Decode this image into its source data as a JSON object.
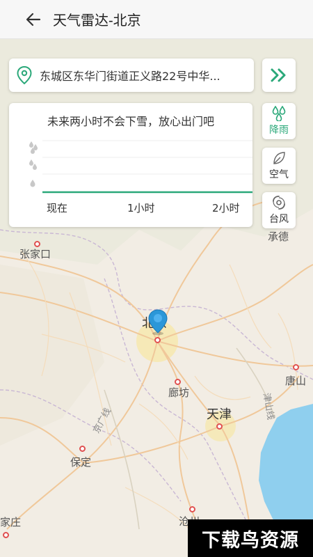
{
  "header": {
    "title": "天气雷达-北京"
  },
  "address": {
    "text": "东城区东华门街道正义路22号中华..."
  },
  "forecast": {
    "message": "未来两小时不会下雪，放心出门吧",
    "ticks": [
      "现在",
      "1小时",
      "2小时"
    ]
  },
  "side_buttons": {
    "rain": "降雨",
    "air": "空气",
    "typhoon": "台风"
  },
  "map_labels": {
    "zhangjiakou": "张家口",
    "chengde": "承德",
    "beijing": "北京",
    "tangshan": "唐山",
    "langfang": "廊坊",
    "tianjin": "天津",
    "baoding": "保定",
    "shijiazhuang": "家庄",
    "cangzhou": "沧州",
    "jinggang": "京广线",
    "jinshan": "津山线"
  },
  "watermark": "下载鸟资源",
  "colors": {
    "accent": "#2aa879",
    "map_bg": "#f2ede4",
    "water": "#8fcfee",
    "road": "#f0c89a",
    "city": "#e05050"
  }
}
